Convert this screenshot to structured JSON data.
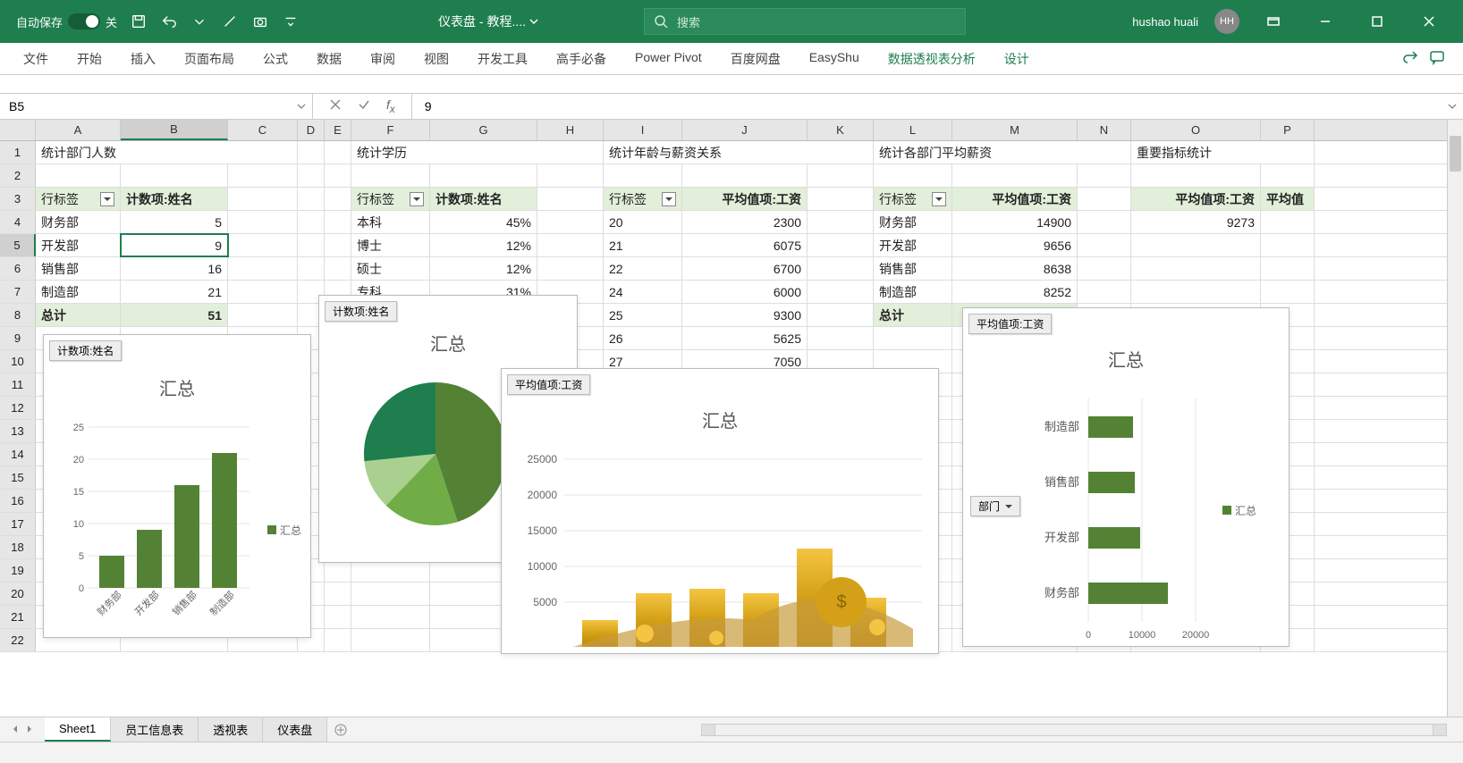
{
  "title_bar": {
    "autosave_label": "自动保存",
    "autosave_state": "关",
    "doc_title": "仪表盘 - 教程....",
    "search_placeholder": "搜索",
    "user_name": "hushao huali",
    "user_initials": "HH"
  },
  "ribbon_tabs": [
    "文件",
    "开始",
    "插入",
    "页面布局",
    "公式",
    "数据",
    "审阅",
    "视图",
    "开发工具",
    "高手必备",
    "Power Pivot",
    "百度网盘",
    "EasyShu"
  ],
  "ribbon_contextual": [
    "数据透视表分析",
    "设计"
  ],
  "formula_bar": {
    "name_box": "B5",
    "formula": "9"
  },
  "columns": [
    "A",
    "B",
    "C",
    "D",
    "E",
    "F",
    "G",
    "H",
    "I",
    "J",
    "K",
    "L",
    "M",
    "N",
    "O",
    "P"
  ],
  "section_headers": {
    "dept_count": "统计部门人数",
    "education": "统计学历",
    "age_salary": "统计年龄与薪资关系",
    "dept_avg_salary": "统计各部门平均薪资",
    "key_metrics": "重要指标统计"
  },
  "pivot_headers": {
    "row_label": "行标签",
    "count_name": "计数项:姓名",
    "avg_salary": "平均值项:工资",
    "total": "总计"
  },
  "dept_count": {
    "rows": [
      [
        "财务部",
        5
      ],
      [
        "开发部",
        9
      ],
      [
        "销售部",
        16
      ],
      [
        "制造部",
        21
      ]
    ],
    "total": 51
  },
  "education": {
    "rows": [
      [
        "本科",
        "45%"
      ],
      [
        "博士",
        "12%"
      ],
      [
        "硕士",
        "12%"
      ],
      [
        "专科",
        "31%"
      ]
    ]
  },
  "age_salary": {
    "rows": [
      [
        20,
        2300
      ],
      [
        21,
        6075
      ],
      [
        22,
        6700
      ],
      [
        24,
        6000
      ],
      [
        25,
        9300
      ],
      [
        26,
        5625
      ],
      [
        27,
        7050
      ]
    ]
  },
  "dept_avg": {
    "rows": [
      [
        "财务部",
        14900
      ],
      [
        "开发部",
        9656
      ],
      [
        "销售部",
        8638
      ],
      [
        "制造部",
        8252
      ]
    ],
    "total": 9273
  },
  "key_metric_value": 9273,
  "selected_cell": "B5",
  "chart_labels": {
    "count_name": "计数项:姓名",
    "avg_salary": "平均值项:工资",
    "summary_title": "汇总",
    "legend": "汇总",
    "dept_slicer": "部门"
  },
  "chart_data": [
    {
      "type": "bar",
      "title": "汇总",
      "field": "计数项:姓名",
      "categories": [
        "财务部",
        "开发部",
        "销售部",
        "制造部"
      ],
      "series": [
        {
          "name": "汇总",
          "values": [
            5,
            9,
            16,
            21
          ]
        }
      ],
      "ylim": [
        0,
        25
      ],
      "yticks": [
        0,
        5,
        10,
        15,
        20,
        25
      ]
    },
    {
      "type": "pie",
      "title": "汇总",
      "field": "计数项:姓名",
      "categories": [
        "本科",
        "博士",
        "硕士",
        "专科"
      ],
      "values": [
        45,
        12,
        12,
        31
      ]
    },
    {
      "type": "bar",
      "title": "汇总",
      "field": "平均值项:工资",
      "orientation": "vertical-with-image-fill",
      "yticks": [
        5000,
        10000,
        15000,
        20000,
        25000
      ]
    },
    {
      "type": "bar",
      "title": "汇总",
      "field": "平均值项:工资",
      "orientation": "horizontal",
      "categories": [
        "制造部",
        "销售部",
        "开发部",
        "财务部"
      ],
      "series": [
        {
          "name": "汇总",
          "values": [
            8252,
            8638,
            9656,
            14900
          ]
        }
      ],
      "xlim": [
        0,
        20000
      ],
      "xticks": [
        0,
        10000,
        20000
      ]
    }
  ],
  "sheet_tabs": [
    "Sheet1",
    "员工信息表",
    "透视表",
    "仪表盘"
  ],
  "active_sheet": "Sheet1"
}
